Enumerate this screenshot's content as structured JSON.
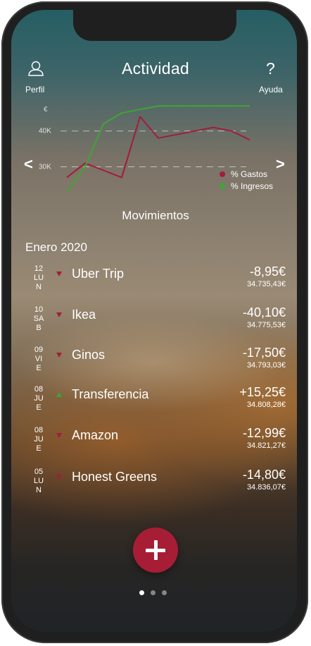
{
  "header": {
    "title": "Actividad",
    "left_label": "Perfil",
    "right_label": "Ayuda",
    "left_icon": "user-icon",
    "right_icon": "help-icon",
    "help_glyph": "?"
  },
  "chart_data": {
    "type": "line",
    "y_unit_label": "€",
    "ytick_labels": [
      "40K",
      "30K"
    ],
    "x": [
      0,
      1,
      2,
      3,
      4,
      5,
      6,
      7,
      8,
      9,
      10
    ],
    "series": [
      {
        "name": "% Gastos",
        "color": "#a21d3a",
        "values": [
          27,
          31,
          29,
          27,
          44,
          38,
          39,
          40,
          41,
          40,
          37.5
        ]
      },
      {
        "name": "% Ingresos",
        "color": "#3fa534",
        "values": [
          23,
          30,
          42,
          45,
          46,
          47,
          47,
          47,
          47,
          47,
          47
        ]
      }
    ],
    "ylim": [
      23,
      49
    ],
    "grid_lines_at": [
      40,
      30
    ]
  },
  "nav": {
    "prev": "<",
    "next": ">"
  },
  "section_title": "Movimientos",
  "month": "Enero 2020",
  "transactions": [
    {
      "day": "12",
      "weekday_top": "LU",
      "weekday_bottom": "N",
      "name": "Uber Trip",
      "amount": "-8,95€",
      "balance": "34.735,43€",
      "direction": "down"
    },
    {
      "day": "10",
      "weekday_top": "SA",
      "weekday_bottom": "B",
      "name": "Ikea",
      "amount": "-40,10€",
      "balance": "34.775,53€",
      "direction": "down"
    },
    {
      "day": "09",
      "weekday_top": "VI",
      "weekday_bottom": "E",
      "name": "Ginos",
      "amount": "-17,50€",
      "balance": "34.793,03€",
      "direction": "down"
    },
    {
      "day": "08",
      "weekday_top": "JU",
      "weekday_bottom": "E",
      "name": "Transferencia",
      "amount": "+15,25€",
      "balance": "34.808,28€",
      "direction": "up"
    },
    {
      "day": "08",
      "weekday_top": "JU",
      "weekday_bottom": "E",
      "name": "Amazon",
      "amount": "-12,99€",
      "balance": "34.821,27€",
      "direction": "down"
    },
    {
      "day": "05",
      "weekday_top": "LU",
      "weekday_bottom": "N",
      "name": "Honest Greens",
      "amount": "-14,80€",
      "balance": "34.836,07€",
      "direction": "down"
    }
  ],
  "fab_icon": "plus-icon",
  "pager": {
    "count": 3,
    "active": 0
  }
}
